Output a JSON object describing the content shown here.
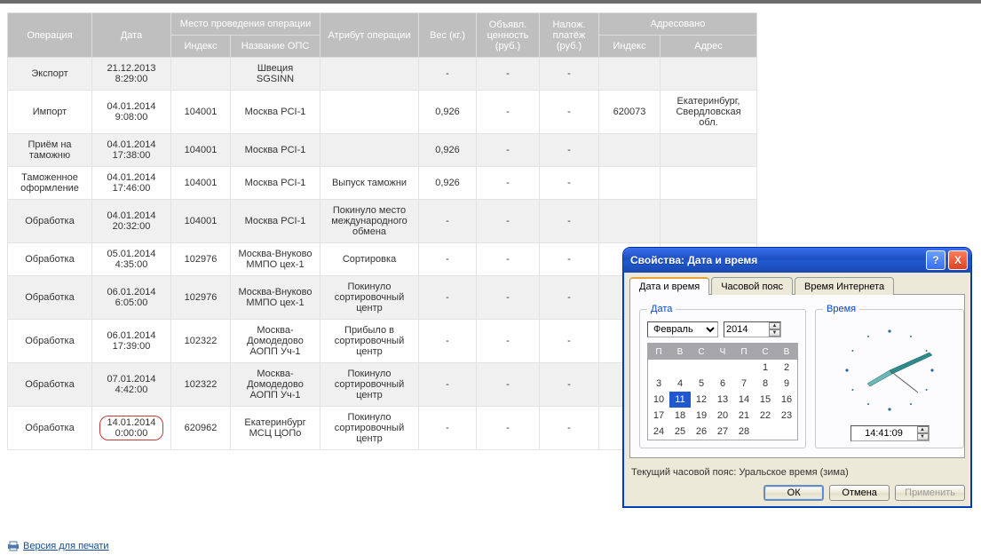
{
  "table": {
    "headers": {
      "operation": "Операция",
      "date": "Дата",
      "place_group": "Место проведения операции",
      "index": "Индекс",
      "ops_name": "Название ОПС",
      "attribute": "Атрибут операции",
      "weight": "Вес (кг.)",
      "declared": "Объявл. ценность (руб.)",
      "cod": "Налож. платёж (руб.)",
      "addressee_group": "Адресовано",
      "a_index": "Индекс",
      "a_addr": "Адрес"
    },
    "rows": [
      {
        "op": "Экспорт",
        "date": "21.12.2013 8:29:00",
        "idx": "",
        "ops": "Швеция SGSINN",
        "attr": "",
        "wt": "-",
        "decl": "-",
        "cod": "-",
        "aidx": "",
        "addr": ""
      },
      {
        "op": "Импорт",
        "date": "04.01.2014 9:08:00",
        "idx": "104001",
        "ops": "Москва PCI-1",
        "attr": "",
        "wt": "0,926",
        "decl": "-",
        "cod": "-",
        "aidx": "620073",
        "addr": "Екатеринбург, Свердловская обл."
      },
      {
        "op": "Приём на таможню",
        "date": "04.01.2014 17:38:00",
        "idx": "104001",
        "ops": "Москва PCI-1",
        "attr": "",
        "wt": "0,926",
        "decl": "-",
        "cod": "-",
        "aidx": "",
        "addr": ""
      },
      {
        "op": "Таможенное оформление",
        "date": "04.01.2014 17:46:00",
        "idx": "104001",
        "ops": "Москва PCI-1",
        "attr": "Выпуск таможни",
        "wt": "0,926",
        "decl": "-",
        "cod": "-",
        "aidx": "",
        "addr": ""
      },
      {
        "op": "Обработка",
        "date": "04.01.2014 20:32:00",
        "idx": "104001",
        "ops": "Москва PCI-1",
        "attr": "Покинуло место международного обмена",
        "wt": "-",
        "decl": "-",
        "cod": "-",
        "aidx": "",
        "addr": ""
      },
      {
        "op": "Обработка",
        "date": "05.01.2014 4:35:00",
        "idx": "102976",
        "ops": "Москва-Внуково ММПО цех-1",
        "attr": "Сортировка",
        "wt": "-",
        "decl": "-",
        "cod": "-",
        "aidx": "",
        "addr": ""
      },
      {
        "op": "Обработка",
        "date": "06.01.2014 6:05:00",
        "idx": "102976",
        "ops": "Москва-Внуково ММПО цех-1",
        "attr": "Покинуло сортировочный центр",
        "wt": "-",
        "decl": "-",
        "cod": "-",
        "aidx": "",
        "addr": ""
      },
      {
        "op": "Обработка",
        "date": "06.01.2014 17:39:00",
        "idx": "102322",
        "ops": "Москва-Домодедово АОПП Уч-1",
        "attr": "Прибыло в сортировочный центр",
        "wt": "-",
        "decl": "-",
        "cod": "-",
        "aidx": "",
        "addr": ""
      },
      {
        "op": "Обработка",
        "date": "07.01.2014 4:42:00",
        "idx": "102322",
        "ops": "Москва-Домодедово АОПП Уч-1",
        "attr": "Покинуло сортировочный центр",
        "wt": "-",
        "decl": "-",
        "cod": "-",
        "aidx": "",
        "addr": ""
      },
      {
        "op": "Обработка",
        "date": "14.01.2014 0:00:00",
        "idx": "620962",
        "ops": "Екатеринбург МСЦ ЦОПо",
        "attr": "Покинуло сортировочный центр",
        "wt": "-",
        "decl": "-",
        "cod": "-",
        "aidx": "",
        "addr": "",
        "circled": true
      }
    ],
    "print_link": "Версия для печати"
  },
  "dialog": {
    "title": "Свойства: Дата и время",
    "help": "?",
    "close": "X",
    "tabs": {
      "datetime": "Дата и время",
      "tz": "Часовой пояс",
      "net": "Время Интернета"
    },
    "date_legend": "Дата",
    "time_legend": "Время",
    "month": "Февраль",
    "year": "2014",
    "dow": [
      "П",
      "В",
      "С",
      "Ч",
      "П",
      "С",
      "В"
    ],
    "weeks": [
      [
        "",
        "",
        "",
        "",
        "",
        "1",
        "2"
      ],
      [
        "3",
        "4",
        "5",
        "6",
        "7",
        "8",
        "9"
      ],
      [
        "10",
        "11",
        "12",
        "13",
        "14",
        "15",
        "16"
      ],
      [
        "17",
        "18",
        "19",
        "20",
        "21",
        "22",
        "23"
      ],
      [
        "24",
        "25",
        "26",
        "27",
        "28",
        "",
        ""
      ]
    ],
    "selected_day": "11",
    "tz_note": "Текущий часовой пояс: Уральское время (зима)",
    "time_value": "14:41:09",
    "ok": "ОК",
    "cancel": "Отмена",
    "apply": "Применить"
  }
}
